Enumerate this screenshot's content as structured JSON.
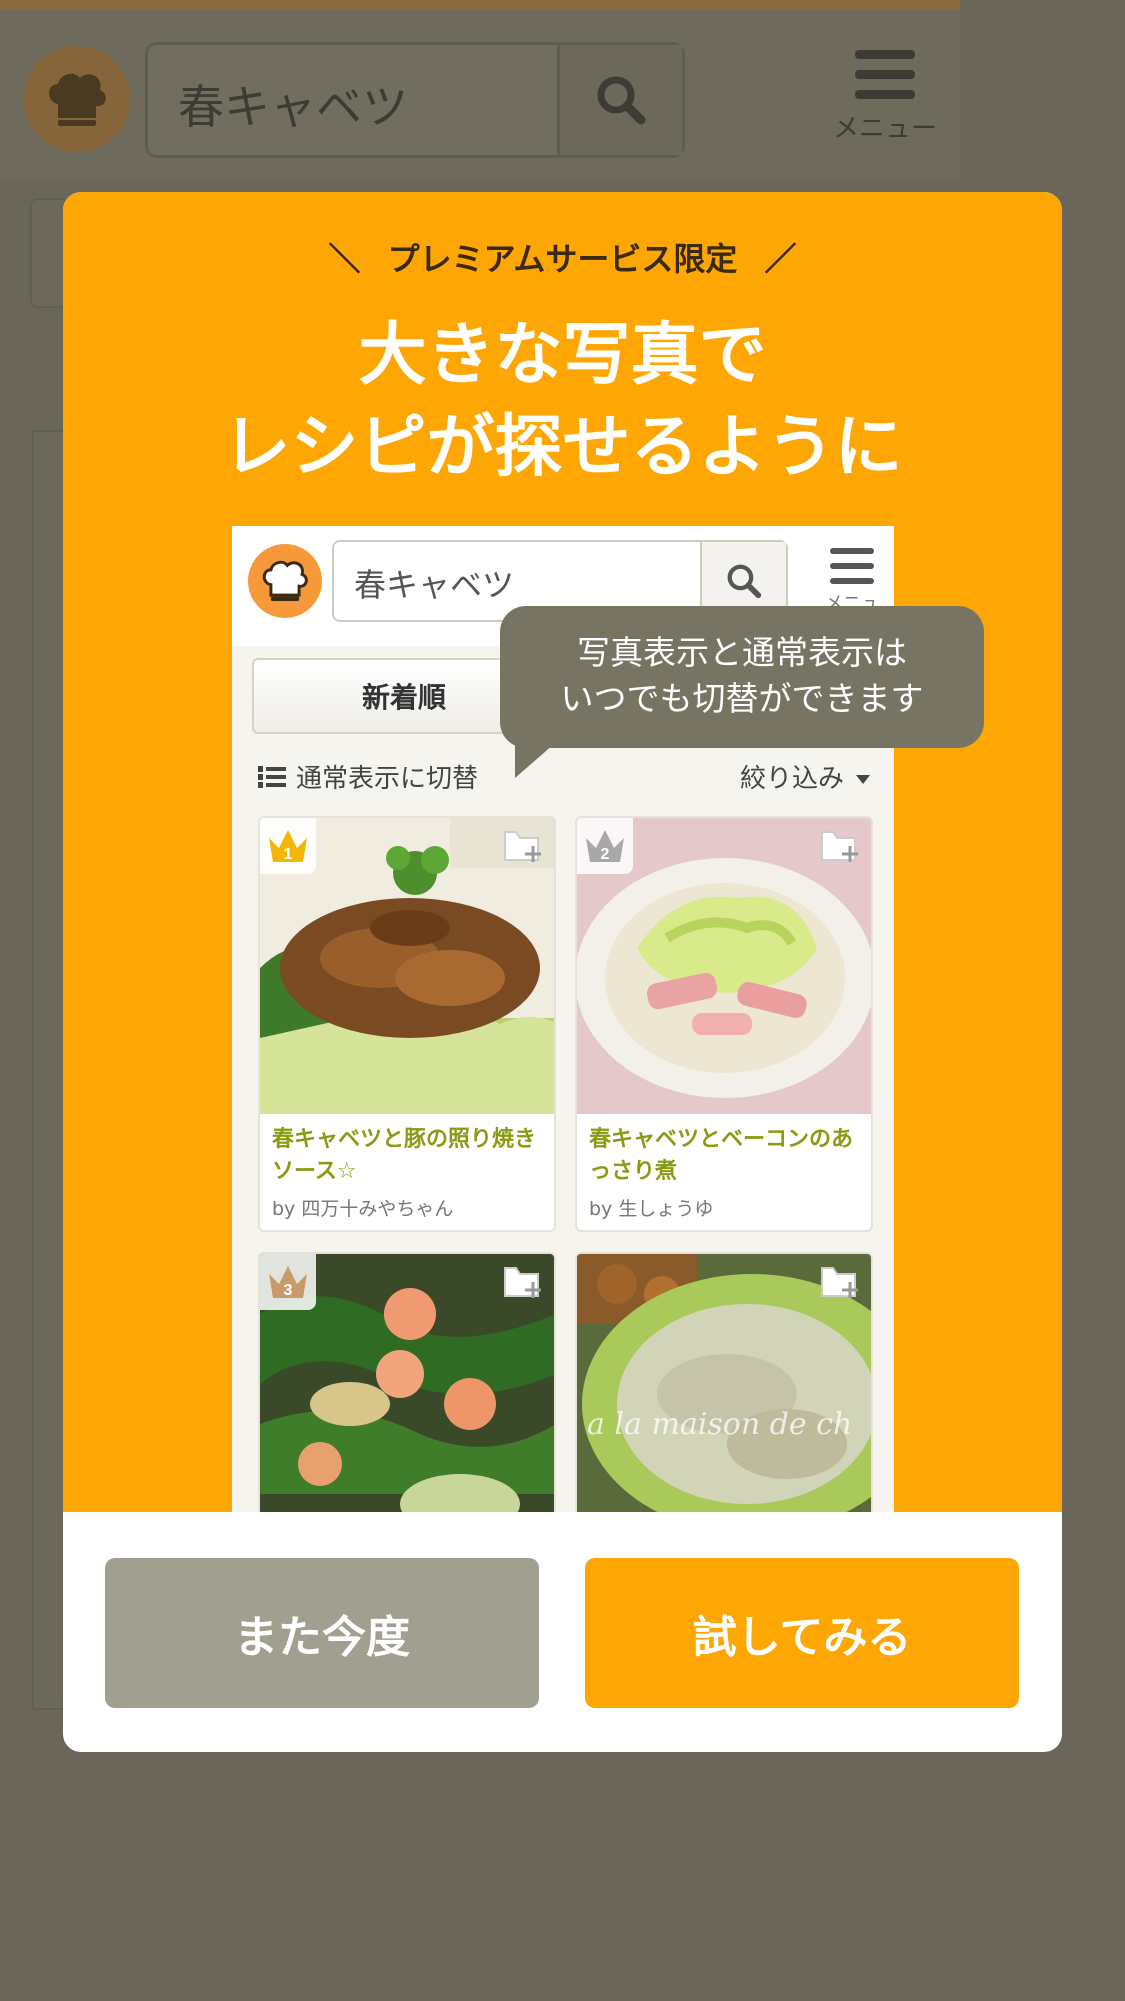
{
  "background": {
    "search_value": "春キャベツ",
    "menu_label": "メニュー"
  },
  "modal": {
    "tagline_left": "＼",
    "tagline": "プレミアムサービス限定",
    "tagline_right": "／",
    "headline_line1": "大きな写真で",
    "headline_line2": "レシピが探せるように",
    "preview": {
      "search_value": "春キャベツ",
      "menu_label": "メニュー",
      "sort_label": "新着順",
      "toggle_label": "通常表示に切替",
      "filter_label": "絞り込み",
      "tooltip_line1": "写真表示と通常表示は",
      "tooltip_line2": "いつでも切替ができます",
      "cards": [
        {
          "rank": "1",
          "title": "春キャベツと豚の照り焼きソース☆",
          "author": "by 四万十みやちゃん",
          "crown_color": "#f2b705"
        },
        {
          "rank": "2",
          "title": "春キャベツとベーコンのあっさり煮",
          "author": "by 生しょうゆ",
          "crown_color": "#a8a8a8"
        },
        {
          "rank": "3",
          "title": "",
          "author": "",
          "crown_color": "#c99a6a"
        },
        {
          "rank": "",
          "title": "",
          "author": "",
          "crown_color": ""
        }
      ],
      "photo_watermark": "a la maison de ch"
    },
    "buttons": {
      "later": "また今度",
      "try": "試してみる"
    }
  },
  "colors": {
    "accent_orange": "#fea704",
    "overlay": "#6a675a",
    "secondary_button": "#a19f8f",
    "tooltip": "#787463"
  }
}
